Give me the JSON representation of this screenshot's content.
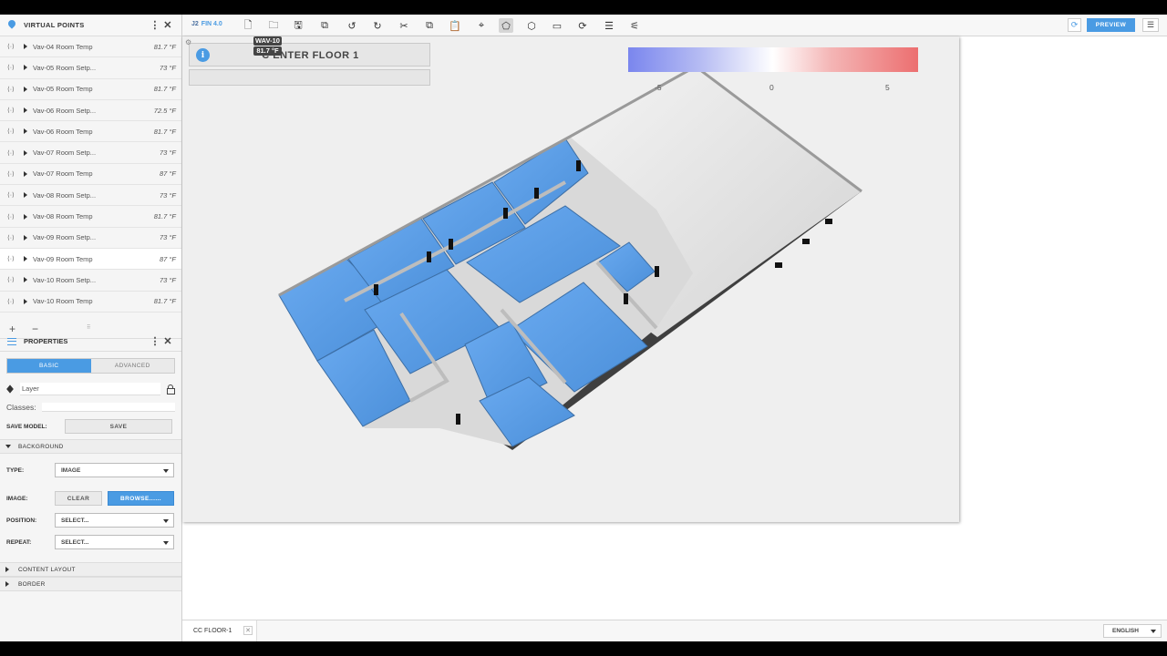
{
  "virtual_points": {
    "title": "VIRTUAL POINTS",
    "items": [
      {
        "name": "Vav-04 Room Temp",
        "value": "81.7 °F"
      },
      {
        "name": "Vav-05 Room Setp...",
        "value": "73 °F"
      },
      {
        "name": "Vav-05 Room Temp",
        "value": "81.7 °F"
      },
      {
        "name": "Vav-06 Room Setp...",
        "value": "72.5 °F"
      },
      {
        "name": "Vav-06 Room Temp",
        "value": "81.7 °F"
      },
      {
        "name": "Vav-07 Room Setp...",
        "value": "73 °F"
      },
      {
        "name": "Vav-07 Room Temp",
        "value": "87 °F"
      },
      {
        "name": "Vav-08 Room Setp...",
        "value": "73 °F"
      },
      {
        "name": "Vav-08 Room Temp",
        "value": "81.7 °F"
      },
      {
        "name": "Vav-09 Room Setp...",
        "value": "73 °F"
      },
      {
        "name": "Vav-09 Room Temp",
        "value": "87 °F"
      },
      {
        "name": "Vav-10 Room Setp...",
        "value": "73 °F"
      },
      {
        "name": "Vav-10 Room Temp",
        "value": "81.7 °F"
      }
    ],
    "selected_index": 10,
    "link_glyph": "⟨·⟩",
    "add_label": "+",
    "remove_label": "−"
  },
  "properties": {
    "title": "PROPERTIES",
    "tabs": [
      "BASIC",
      "ADVANCED"
    ],
    "layer_label": "Layer",
    "classes_label": "Classes:",
    "save_model_label": "SAVE MODEL:",
    "save_button": "SAVE",
    "background": {
      "title": "BACKGROUND",
      "type_label": "TYPE:",
      "type_value": "IMAGE",
      "image_label": "IMAGE:",
      "clear_button": "CLEAR",
      "browse_button": "BROWSE......",
      "position_label": "POSITION:",
      "position_value": "SELECT...",
      "repeat_label": "REPEAT:",
      "repeat_value": "SELECT..."
    },
    "content_layout": "CONTENT LAYOUT",
    "border": "BORDER"
  },
  "toolbar": {
    "brand_prefix": "J2",
    "brand_name": "FIN 4.0",
    "preview_button": "PREVIEW"
  },
  "canvas": {
    "title": "C ENTER FLOOR 1",
    "tooltip_name": "WAV-10",
    "tooltip_value": "81.7 °F",
    "legend_labels": [
      "-5",
      "0",
      "5"
    ],
    "colors": {
      "room_blue": "#5b9ee6",
      "legend_low": "#7a86ee",
      "legend_high": "#ec6f70",
      "accent": "#4a9be3"
    }
  },
  "bottom": {
    "page_tab": "CC FLOOR-1",
    "language": "ENGLISH"
  }
}
